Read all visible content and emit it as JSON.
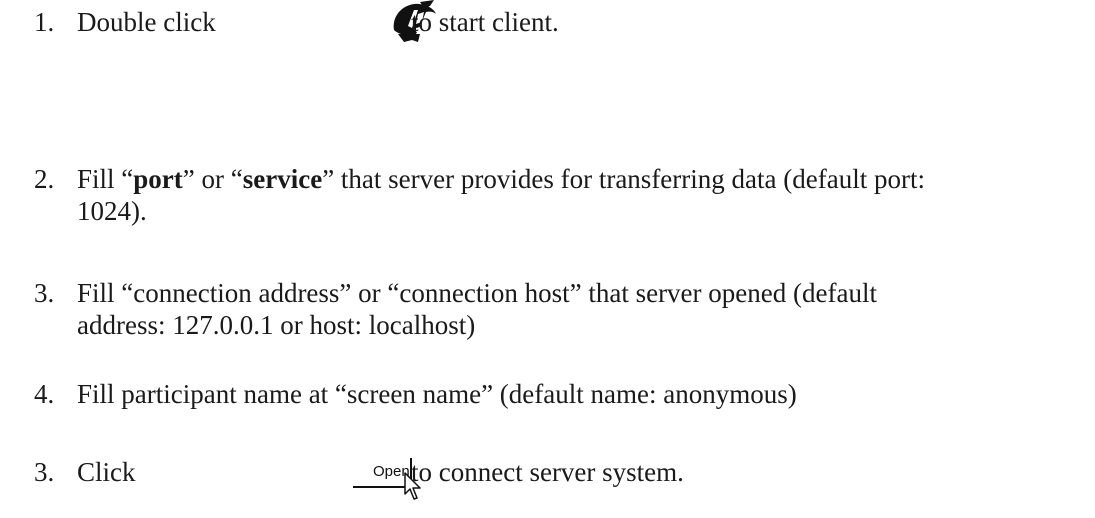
{
  "steps": [
    {
      "number": "1.",
      "text_before": "Double click",
      "icon": "client-app-icon",
      "text_after": "to start client."
    },
    {
      "number": "2.",
      "line1_a": "Fill “",
      "line1_port": "port",
      "line1_b": "” or “",
      "line1_service": "service",
      "line1_c": "” that server provides for transferring data (default port:",
      "line2": "1024)."
    },
    {
      "number": "3.",
      "line1": "Fill “connection address” or “connection host” that server opened (default",
      "line2": "address: 127.0.0.1 or host: localhost)"
    },
    {
      "number": "4.",
      "line1": "Fill participant name at “screen name” (default name: anonymous)"
    },
    {
      "number": "3.",
      "text_before": "Click",
      "button_label": "Open",
      "icon": "pointer-cursor-icon",
      "text_after": "to connect server system."
    }
  ]
}
